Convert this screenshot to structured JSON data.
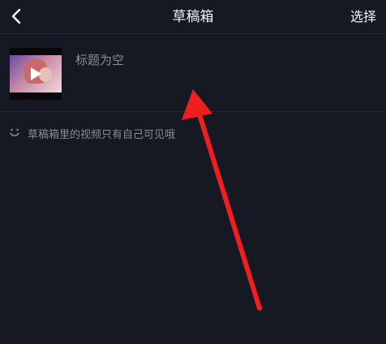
{
  "navbar": {
    "title": "草稿箱",
    "select_label": "选择",
    "back_icon": "chevron-left-icon"
  },
  "draft": {
    "title": "标题为空",
    "thumbnail_icon": "play-icon"
  },
  "notice": {
    "icon": "smile-icon",
    "text": "草稿箱里的视频只有自己可见哦"
  },
  "colors": {
    "background": "#161823",
    "annotation_arrow": "#f01e1e",
    "muted_text": "#8a8b93"
  }
}
